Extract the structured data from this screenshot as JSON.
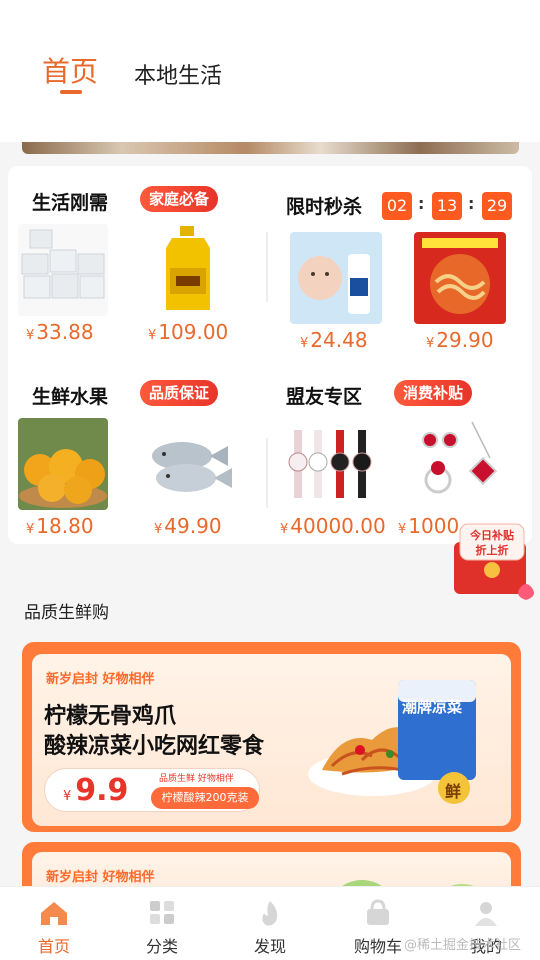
{
  "top_tabs": {
    "home": "首页",
    "local": "本地生活"
  },
  "sections": {
    "life": {
      "title": "生活刚需",
      "badge": "家庭必备",
      "prices": [
        "33.88",
        "109.00"
      ]
    },
    "flash": {
      "title": "限时秒杀",
      "timer": [
        "02",
        "13",
        "29"
      ],
      "prices": [
        "24.48",
        "29.90"
      ]
    },
    "fresh": {
      "title": "生鲜水果",
      "badge": "品质保证",
      "prices": [
        "18.80",
        "49.90"
      ]
    },
    "partner": {
      "title": "盟友专区",
      "badge": "消费补贴",
      "prices": [
        "40000.00",
        "1000"
      ]
    },
    "currency": "¥"
  },
  "floating": {
    "line1": "今日补贴",
    "line2": "折上折"
  },
  "quality_heading": "品质生鲜购",
  "promo": {
    "tag": "新岁启封 好物相伴",
    "title1": "柠檬无骨鸡爪",
    "title2": "酸辣凉菜小吃网红零食",
    "price": "9.9",
    "small": "品质生鲜 好物相伴",
    "pill": "柠檬酸辣200克装",
    "product_text": "潮牌凉菜",
    "seal": "鲜"
  },
  "promo2": {
    "tag": "新岁启封 好物相伴"
  },
  "nav": [
    {
      "label": "首页",
      "icon": "home-icon"
    },
    {
      "label": "分类",
      "icon": "category-icon"
    },
    {
      "label": "发现",
      "icon": "discover-icon"
    },
    {
      "label": "购物车",
      "icon": "cart-icon"
    },
    {
      "label": "我的",
      "icon": "user-icon"
    }
  ],
  "watermark": "@稀土掘金技术社区",
  "colors": {
    "accent": "#e8692c",
    "badge": "#e8342a",
    "timer": "#ff5a1f"
  }
}
